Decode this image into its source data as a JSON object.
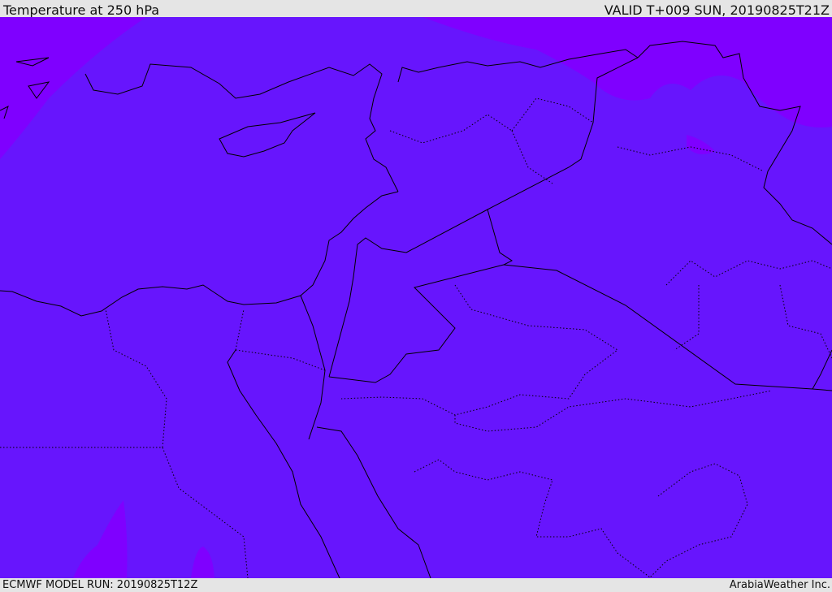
{
  "title": "Temperature at 250 hPa",
  "valid": "VALID T+009 SUN, 20190825T21Z",
  "model_run": "ECMWF MODEL RUN: 20190825T12Z",
  "credit": "ArabiaWeather Inc.",
  "colors": {
    "base_fill": "#6715fd",
    "cold_fill": "#7f00ff",
    "border": "#000000"
  }
}
